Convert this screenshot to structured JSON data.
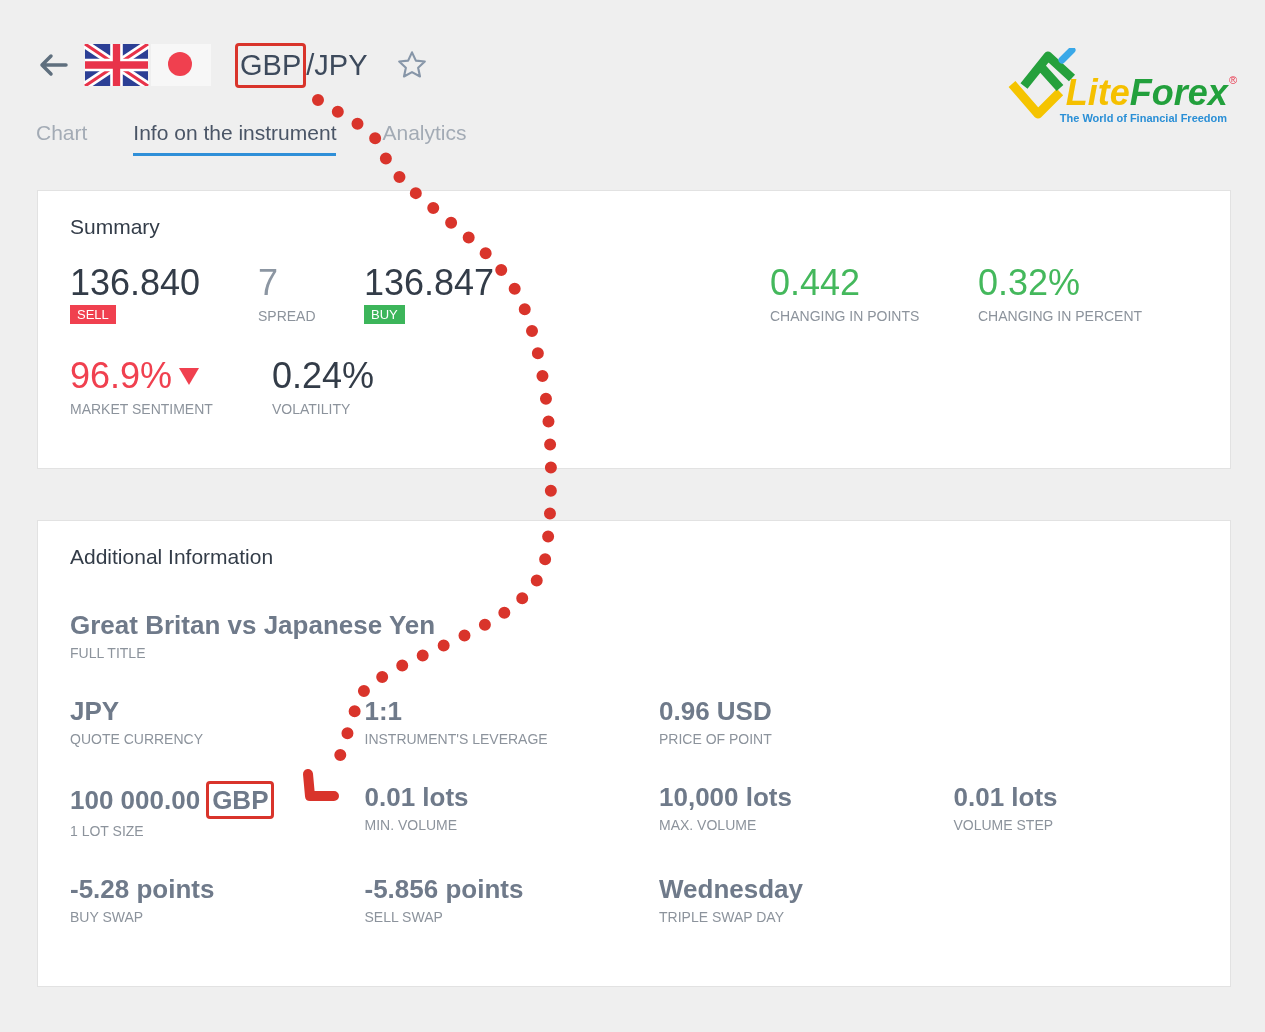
{
  "header": {
    "title_parts": [
      {
        "text": "GBP",
        "highlighted": true
      },
      {
        "text": "/JPY",
        "highlighted": false
      }
    ],
    "favorite": false
  },
  "logo": {
    "words": [
      "Lite",
      "Forex"
    ],
    "mark": "®",
    "tagline": "The World of Financial Freedom"
  },
  "tabs": [
    {
      "label": "Chart",
      "selected": false
    },
    {
      "label": "Info on the instrument",
      "selected": true
    },
    {
      "label": "Analytics",
      "selected": false
    }
  ],
  "summary": {
    "title": "Summary",
    "quotes": [
      {
        "kind": "sell",
        "value": "136.840",
        "badge": "SELL"
      },
      {
        "kind": "spread",
        "value": "7",
        "label": "SPREAD"
      },
      {
        "kind": "buy",
        "value": "136.847",
        "badge": "BUY"
      }
    ],
    "changes": [
      {
        "value": "0.442",
        "label": "CHANGING IN POINTS"
      },
      {
        "value": "0.32%",
        "label": "CHANGING IN PERCENT"
      }
    ],
    "sentiment": {
      "value": "96.9%",
      "label": "MARKET SENTIMENT",
      "falling": true
    },
    "volatility": {
      "value": "0.24%",
      "label": "VOLATILITY"
    }
  },
  "additional": {
    "title": "Additional Information",
    "full_title": {
      "value": "Great Britan vs Japanese Yen",
      "label": "FULL TITLE"
    },
    "rows": [
      [
        {
          "value": "JPY",
          "label": "QUOTE CURRENCY"
        },
        {
          "value": "1:1",
          "label": "INSTRUMENT'S LEVERAGE"
        },
        {
          "value": "0.96 USD",
          "label": "PRICE OF POINT"
        }
      ],
      [
        {
          "value_parts": [
            {
              "text": "100 000.00",
              "highlighted": false
            },
            {
              "text": "GBP",
              "highlighted": true
            }
          ],
          "label": "1 LOT SIZE"
        },
        {
          "value": "0.01 lots",
          "label": "MIN. VOLUME"
        },
        {
          "value": "10,000 lots",
          "label": "MAX. VOLUME"
        },
        {
          "value": "0.01 lots",
          "label": "VOLUME STEP"
        }
      ],
      [
        {
          "value": "-5.28 points",
          "label": "BUY SWAP"
        },
        {
          "value": "-5.856 points",
          "label": "SELL SWAP"
        },
        {
          "value": "Wednesday",
          "label": "TRIPLE SWAP DAY"
        }
      ]
    ]
  },
  "annotations": [
    {
      "kind": "dotted-arrow"
    }
  ]
}
